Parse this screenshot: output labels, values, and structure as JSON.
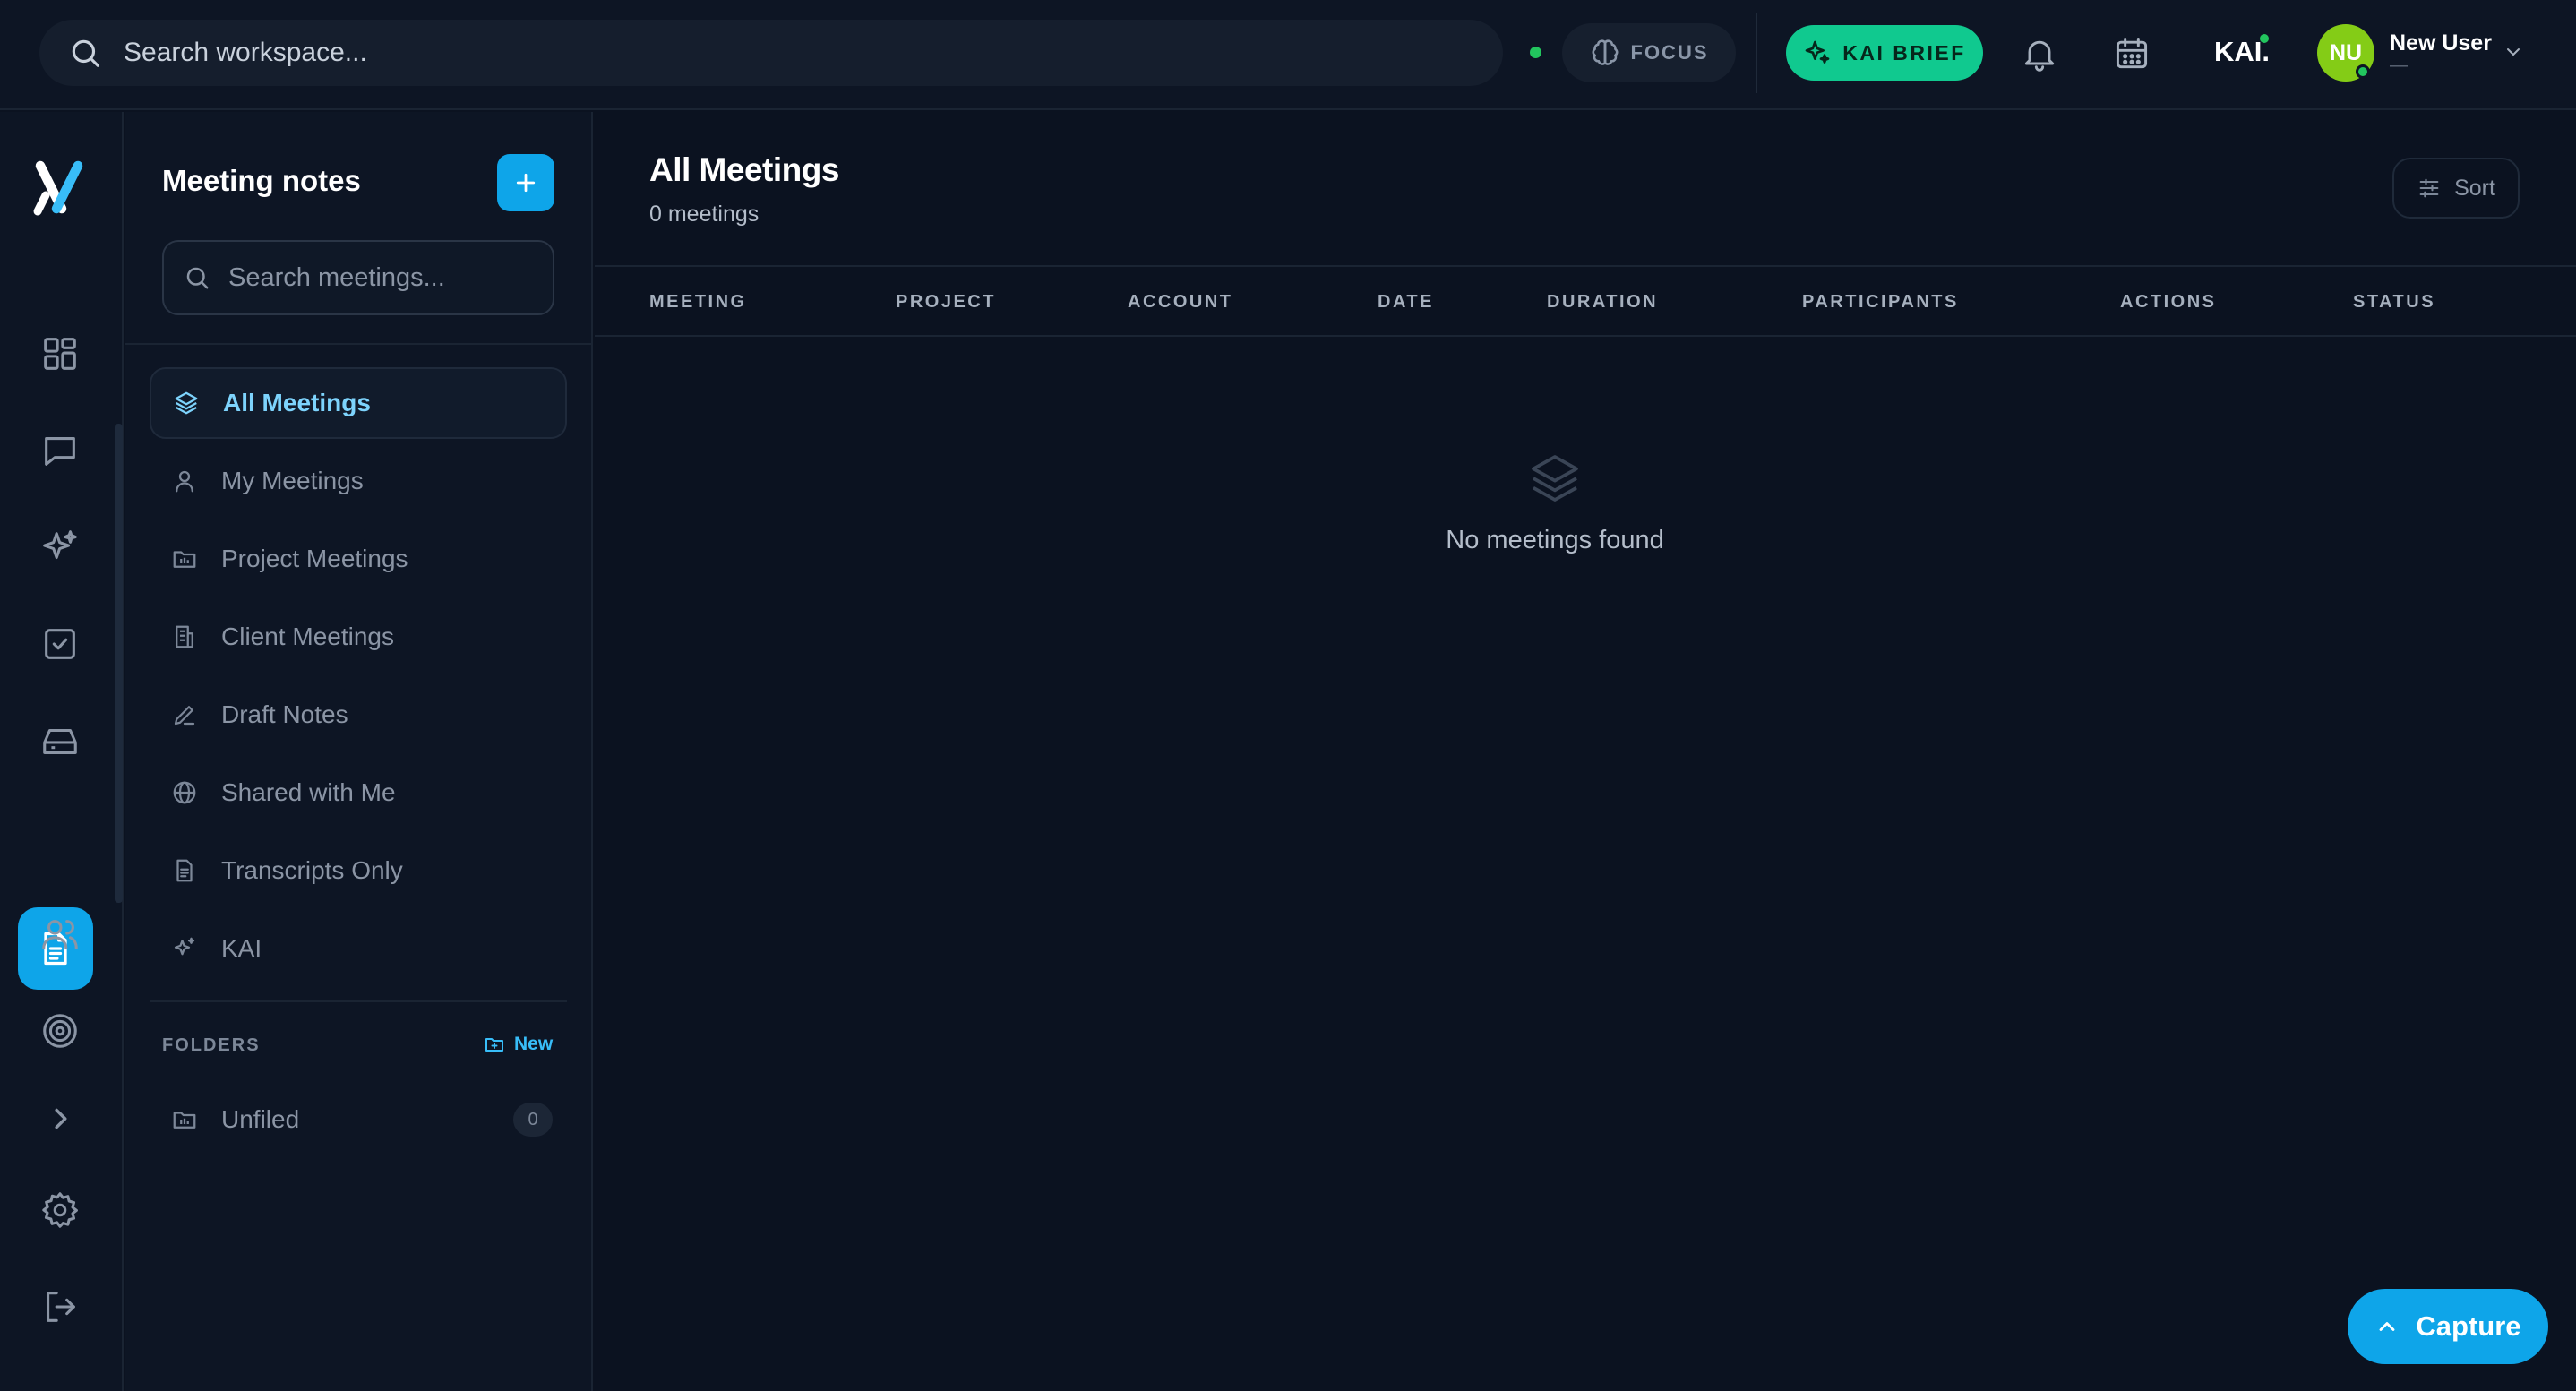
{
  "topbar": {
    "search_placeholder": "Search workspace...",
    "focus_label": "FOCUS",
    "brief_label": "KAI BRIEF",
    "kai_logo": "KAI.",
    "user": {
      "initials": "NU",
      "name": "New User",
      "subtitle": "—"
    }
  },
  "sidebar": {
    "title": "Meeting notes",
    "search_placeholder": "Search meetings...",
    "nav": [
      {
        "label": "All Meetings",
        "icon": "layers-icon",
        "active": true
      },
      {
        "label": "My Meetings",
        "icon": "user-icon"
      },
      {
        "label": "Project Meetings",
        "icon": "folder-icon"
      },
      {
        "label": "Client Meetings",
        "icon": "building-icon"
      },
      {
        "label": "Draft Notes",
        "icon": "pen-icon"
      },
      {
        "label": "Shared with Me",
        "icon": "globe-icon"
      },
      {
        "label": "Transcripts Only",
        "icon": "document-icon"
      },
      {
        "label": "KAI",
        "icon": "sparkle-icon"
      }
    ],
    "folders_label": "FOLDERS",
    "folders_new_label": "New",
    "folders": [
      {
        "label": "Unfiled",
        "count": "0"
      }
    ]
  },
  "main": {
    "title": "All Meetings",
    "subtitle": "0 meetings",
    "sort_label": "Sort",
    "columns": [
      "MEETING",
      "PROJECT",
      "ACCOUNT",
      "DATE",
      "DURATION",
      "PARTICIPANTS",
      "ACTIONS",
      "STATUS"
    ],
    "empty_text": "No meetings found"
  },
  "capture_label": "Capture",
  "colors": {
    "background": "#0b1220",
    "panel": "#0d1524",
    "accent": "#0ea5e9",
    "brief": "#10c98f",
    "online": "#22c55e",
    "avatar": "#84cc16"
  }
}
